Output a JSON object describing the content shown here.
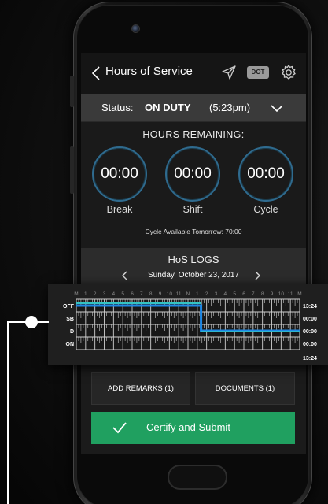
{
  "nav": {
    "title": "Hours of Service",
    "icons": [
      "chevron-left-icon",
      "send-icon",
      "gear-icon"
    ],
    "dot_label": "DOT"
  },
  "status": {
    "label": "Status:",
    "value": "ON DUTY",
    "time": "(5:23pm)"
  },
  "hours_remaining": {
    "title": "HOURS REMAINING:",
    "timers": [
      {
        "value": "00:00",
        "label": "Break"
      },
      {
        "value": "00:00",
        "label": "Shift"
      },
      {
        "value": "00:00",
        "label": "Cycle"
      }
    ],
    "note": "Cycle Available Tomorrow: 70:00"
  },
  "logs": {
    "title": "HoS LOGS",
    "date": "Sunday, October 23, 2017",
    "hour_labels": [
      "M",
      "1",
      "2",
      "3",
      "4",
      "5",
      "6",
      "7",
      "8",
      "9",
      "10",
      "11",
      "N",
      "1",
      "2",
      "3",
      "4",
      "5",
      "6",
      "7",
      "8",
      "9",
      "10",
      "11",
      "M"
    ],
    "rows": [
      {
        "label": "OFF",
        "total": "13:24"
      },
      {
        "label": "SB",
        "total": "00:00"
      },
      {
        "label": "D",
        "total": "00:00"
      },
      {
        "label": "ON",
        "total": "00:00"
      }
    ],
    "grand_total": "13:24",
    "line_color": "#1e88e5",
    "highlight_color": "#34c3c3"
  },
  "actions": {
    "remarks": "ADD REMARKS (1)",
    "documents": "DOCUMENTS (1)",
    "certify": "Certify and Submit"
  },
  "colors": {
    "accent_green": "#20a060",
    "timer_ring": "#2f6b8f"
  }
}
